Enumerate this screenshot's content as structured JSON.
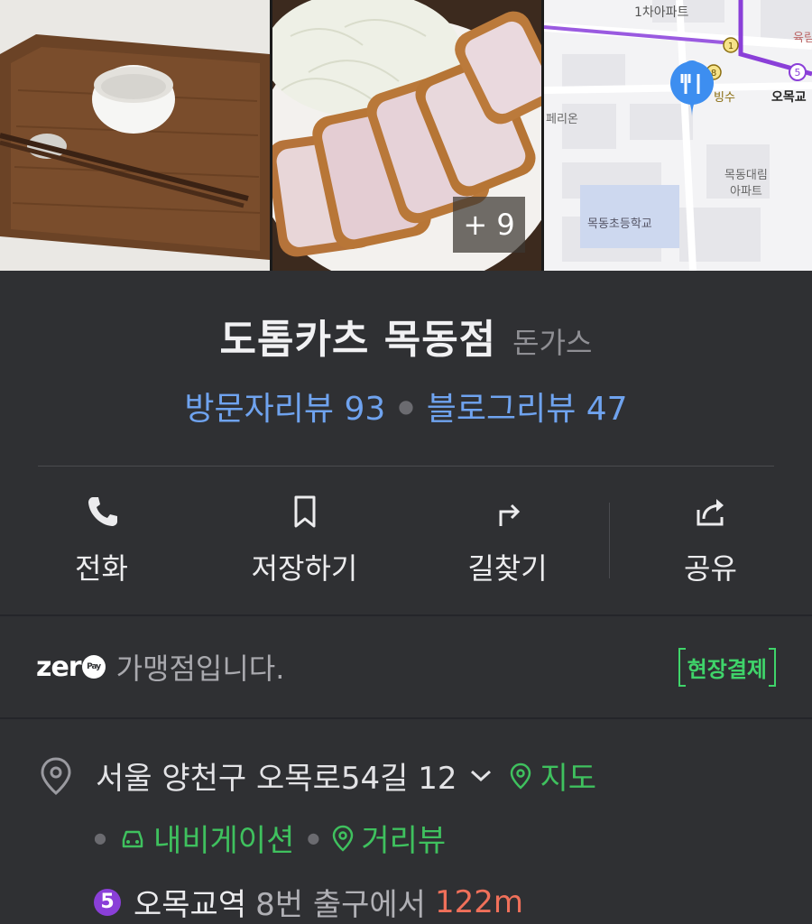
{
  "gallery": {
    "more_count": "+ 9",
    "photos": [
      "tableware-photo",
      "tonkatsu-photo",
      "location-map"
    ],
    "map_labels": {
      "apt1": "1차아파트",
      "station": "오목교",
      "cafe": "빙수",
      "building1": "페리온",
      "apt2": "목동대림",
      "apt2b": "아파트",
      "school": "목동초등학교",
      "shop": "육림"
    },
    "map_markers": {
      "line1": "1",
      "line8": "8",
      "line5": "5"
    }
  },
  "place": {
    "name": "도톰카츠 목동점",
    "category": "돈가스",
    "visitor_review": "방문자리뷰 93",
    "blog_review": "블로그리뷰 47"
  },
  "actions": [
    {
      "label": "전화",
      "icon": "phone-icon"
    },
    {
      "label": "저장하기",
      "icon": "bookmark-icon"
    },
    {
      "label": "길찾기",
      "icon": "directions-icon"
    },
    {
      "label": "공유",
      "icon": "share-icon"
    }
  ],
  "zeropay": {
    "logo_text": "zer",
    "logo_badge": "Pay",
    "text": "가맹점입니다.",
    "onsite_badge": "현장결제"
  },
  "address": {
    "text": "서울 양천구 오목로54길 12",
    "map_link": "지도",
    "navigation": "내비게이션",
    "street_view": "거리뷰",
    "subway_line": "5",
    "station": "오목교역",
    "exit": "8번 출구에서",
    "distance": "122m"
  },
  "colors": {
    "background": "#2f3033",
    "link_blue": "#6fa3ef",
    "green": "#3fc15e",
    "distance_red": "#f0705a",
    "line5_purple": "#8a3fd8"
  }
}
